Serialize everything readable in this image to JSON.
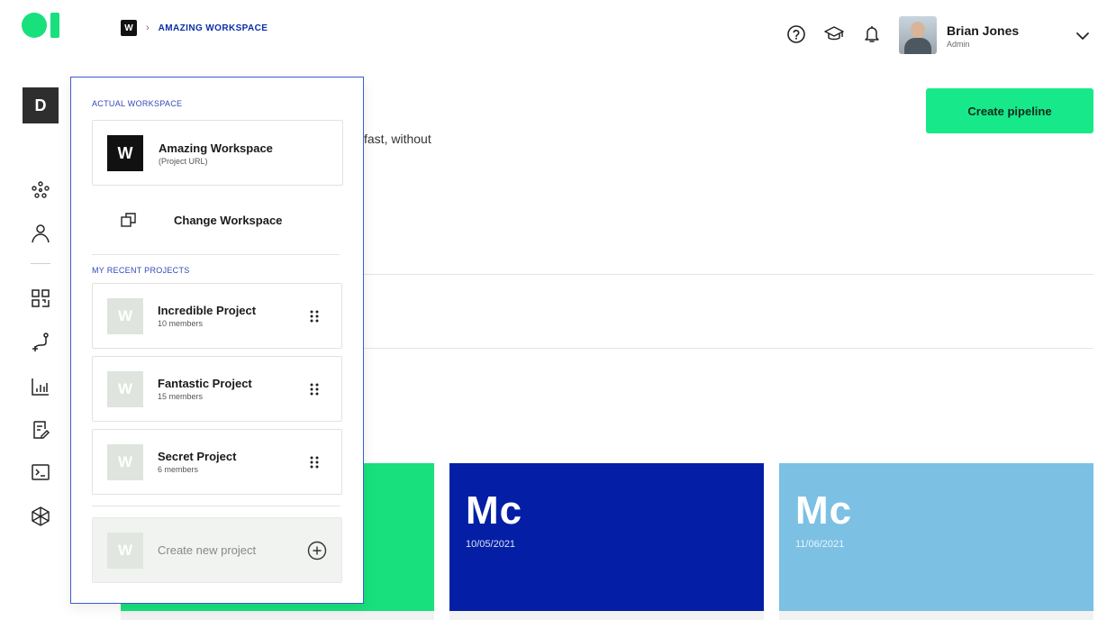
{
  "breadcrumb": {
    "badge": "W",
    "separator": "›",
    "workspace": "AMAZING WORKSPACE"
  },
  "header_icons": [
    "help-circle-icon",
    "graduation-cap-icon",
    "bell-icon"
  ],
  "user": {
    "name": "Brian Jones",
    "role": "Admin"
  },
  "rail": {
    "badge": "D",
    "icons": [
      "network-icon",
      "user-icon",
      "qr-grid-icon",
      "pipeline-icon",
      "bar-chart-icon",
      "edit-document-icon",
      "terminal-icon",
      "hexagon-network-icon"
    ]
  },
  "main": {
    "create_button": "Create pipeline",
    "description_fragment": "fast, without",
    "cards": [
      {
        "title": "",
        "date": "",
        "color": "#17e07c"
      },
      {
        "title": "Mc",
        "date": "10/05/2021",
        "color": "#041fa5"
      },
      {
        "title": "Mc",
        "date": "11/06/2021",
        "color": "#7cc0e4"
      }
    ]
  },
  "dropdown": {
    "actual_label": "ACTUAL WORKSPACE",
    "workspace": {
      "badge": "W",
      "name": "Amazing Workspace",
      "subtitle": "(Project URL)"
    },
    "change_label": "Change Workspace",
    "recent_label": "MY RECENT PROJECTS",
    "projects": [
      {
        "badge": "W",
        "name": "Incredible Project",
        "members": "10 members"
      },
      {
        "badge": "W",
        "name": "Fantastic Project",
        "members": "15 members"
      },
      {
        "badge": "W",
        "name": "Secret Project",
        "members": "6 members"
      }
    ],
    "new_project": {
      "badge": "W",
      "label": "Create new project"
    }
  },
  "colors": {
    "brand_green": "#17e07c",
    "accent_blue": "#3049b8",
    "navy": "#041fa5",
    "sky": "#7cc0e4"
  }
}
